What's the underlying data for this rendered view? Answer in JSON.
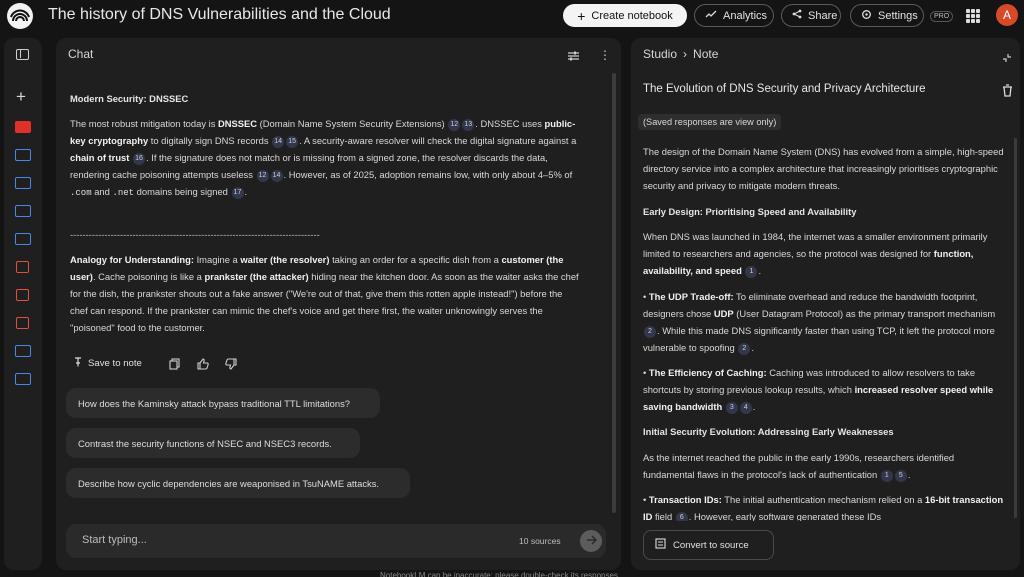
{
  "app": {
    "title": "The history of DNS Vulnerabilities and the Cloud",
    "avatar": "A",
    "pro": "PRO"
  },
  "toolbar": {
    "create": "Create notebook",
    "analytics": "Analytics",
    "share": "Share",
    "settings": "Settings"
  },
  "chat": {
    "header": "Chat",
    "section_title": "Modern Security: DNSSEC",
    "p1": {
      "t1": "The most robust mitigation today is ",
      "b1": "DNSSEC",
      "t2": " (Domain Name System Security Extensions) ",
      "c1": "12",
      "c2": "13",
      "t3": ". DNSSEC uses ",
      "b2": "public-key cryptography",
      "t4": " to digitally sign DNS records ",
      "c3": "14",
      "c4": "15",
      "t5": ". A security-aware resolver will check the digital signature against a ",
      "b3": "chain of trust",
      "t6": " ",
      "c5": "16",
      "t7": ". If the signature does not match or is missing from a signed zone, the resolver discards the data, rendering cache poisoning attempts useless ",
      "c6": "12",
      "c7": "14",
      "t8": ". However, as of 2025, adoption remains low, with only about 4–5% of ",
      "code1": ".com",
      "t9": " and ",
      "code2": ".net",
      "t10": " domains being signed ",
      "c8": "17",
      "t11": "."
    },
    "divider": "--------------------------------------------------------------------------------",
    "p2": {
      "b1": "Analogy for Understanding:",
      "t1": " Imagine a ",
      "b2": "waiter (the resolver)",
      "t2": " taking an order for a specific dish from a ",
      "b3": "customer (the user)",
      "t3": ". Cache poisoning is like a ",
      "b4": "prankster (the attacker)",
      "t4": " hiding near the kitchen door. As soon as the waiter asks the chef for the dish, the prankster shouts out a fake answer (\"We're out of that, give them this rotten apple instead!\") before the chef can respond. If the prankster can mimic the chef's voice and get there first, the waiter unknowingly serves the \"poisoned\" food to the customer."
    },
    "save_to_note": "Save to note",
    "suggestions": [
      "How does the Kaminsky attack bypass traditional TTL limitations?",
      "Contrast the security functions of NSEC and NSEC3 records.",
      "Describe how cyclic dependencies are weaponised in TsuNAME attacks."
    ],
    "input_placeholder": "Start typing...",
    "sources": "10 sources"
  },
  "studio": {
    "breadcrumb_root": "Studio",
    "breadcrumb_leaf": "Note",
    "note_title": "The Evolution of DNS Security and Privacy Architecture",
    "saved_chip": "(Saved responses are view only)",
    "intro": "The design of the Domain Name System (DNS) has evolved from a simple, high-speed directory service into a complex architecture that increasingly prioritises cryptographic security and privacy to mitigate modern threats.",
    "h1": "Early Design: Prioritising Speed and Availability",
    "p1": {
      "t1": "When DNS was launched in 1984, the internet was a smaller environment primarily limited to researchers and agencies, so the protocol was designed for ",
      "b1": "function, availability, and speed",
      "t2": " ",
      "c1": "1",
      "t3": "."
    },
    "bullet1": {
      "b1": "The UDP Trade-off:",
      "t1": " To eliminate overhead and reduce the bandwidth footprint, designers chose ",
      "b2": "UDP",
      "t2": " (User Datagram Protocol) as the primary transport mechanism ",
      "c1": "2",
      "t3": ". While this made DNS significantly faster than using TCP, it left the protocol more vulnerable to spoofing ",
      "c2": "2",
      "t4": "."
    },
    "bullet2": {
      "b1": "The Efficiency of Caching:",
      "t1": " Caching was introduced to allow resolvers to take shortcuts by storing previous lookup results, which ",
      "b2": "increased resolver speed while saving bandwidth",
      "t2": " ",
      "c1": "3",
      "c2": "4",
      "t3": "."
    },
    "h2": "Initial Security Evolution: Addressing Early Weaknesses",
    "p2": {
      "t1": "As the internet reached the public in the early 1990s, researchers identified fundamental flaws in the protocol's lack of authentication ",
      "c1": "1",
      "c2": "5",
      "t2": "."
    },
    "bullet3": {
      "b1": "Transaction IDs:",
      "t1": " The initial authentication mechanism relied on a ",
      "b2": "16-bit transaction ID",
      "t2": " field ",
      "c1": "6",
      "t3": ". However, early software generated these IDs"
    },
    "convert": "Convert to source"
  },
  "footer": "NotebookLM can be inaccurate; please double-check its responses."
}
